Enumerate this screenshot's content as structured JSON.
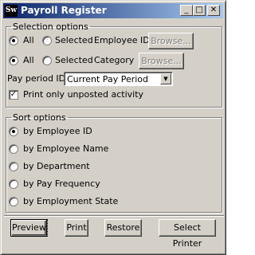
{
  "window": {
    "title": "Payroll Register",
    "icon_label": "Sw",
    "icon_name": "app-icon",
    "controls": {
      "minimize": "_",
      "maximize": "□",
      "close": "✕"
    }
  },
  "selection": {
    "legend": "Selection options",
    "employee": {
      "all_label": "All",
      "selected_label": "Selected",
      "field_label": "Employee ID",
      "browse_label": "Browse...",
      "value": "All"
    },
    "category": {
      "all_label": "All",
      "selected_label": "Selected",
      "field_label": "Category",
      "browse_label": "Browse...",
      "value": "All"
    },
    "pay_period": {
      "label": "Pay period ID",
      "value": "Current Pay Period"
    },
    "unposted": {
      "label": "Print only unposted activity",
      "checked": true
    }
  },
  "sort": {
    "legend": "Sort options",
    "options": [
      {
        "label": "by Employee ID",
        "selected": true
      },
      {
        "label": "by Employee Name",
        "selected": false
      },
      {
        "label": "by Department",
        "selected": false
      },
      {
        "label": "by Pay Frequency",
        "selected": false
      },
      {
        "label": "by Employment State",
        "selected": false
      }
    ]
  },
  "buttons": {
    "preview": "Preview",
    "print": "Print",
    "restore": "Restore",
    "select_printer": "Select Printer"
  }
}
